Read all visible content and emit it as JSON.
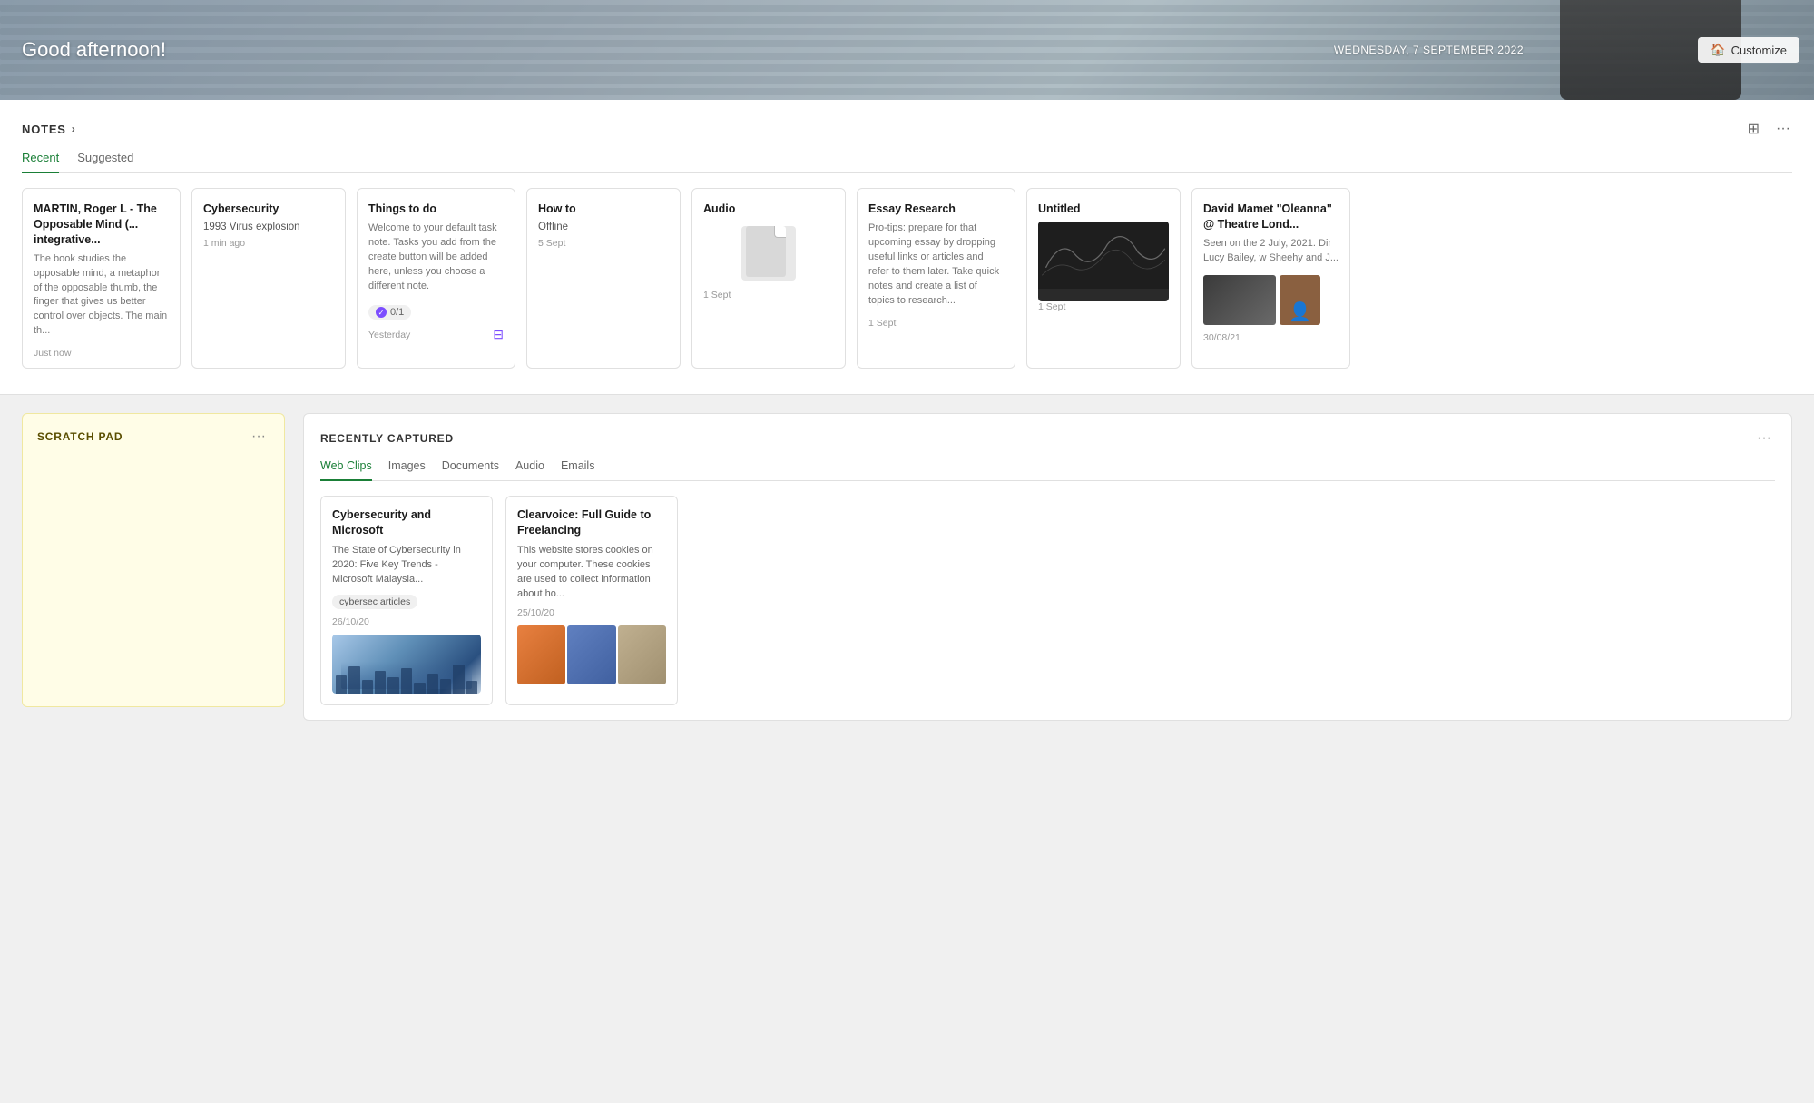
{
  "hero": {
    "greeting": "Good afternoon!",
    "date": "WEDNESDAY, 7 SEPTEMBER 2022",
    "customize_label": "Customize"
  },
  "notes": {
    "title": "NOTES",
    "tabs": [
      {
        "label": "Recent",
        "active": true
      },
      {
        "label": "Suggested",
        "active": false
      }
    ],
    "cards": [
      {
        "id": "martin",
        "title": "MARTIN, Roger L - The Opposable Mind (... integrative...",
        "subtitle": "",
        "body": "The book studies the opposable mind, a metaphor of the opposable thumb, the finger that gives us better control over objects. The main th...",
        "time": "Just now",
        "type": "text"
      },
      {
        "id": "cybersecurity",
        "title": "Cybersecurity",
        "subtitle": "1993 Virus explosion",
        "body": "",
        "time": "1 min ago",
        "type": "text"
      },
      {
        "id": "things-to-do",
        "title": "Things to do",
        "subtitle": "",
        "body": "Welcome to your default task note. Tasks you add from the create button will be added here, unless you choose a different note.",
        "time": "Yesterday",
        "type": "task",
        "todo": "0/1"
      },
      {
        "id": "how-to",
        "title": "How to",
        "subtitle": "Offline",
        "body": "",
        "time": "5 Sept",
        "type": "text"
      },
      {
        "id": "audio",
        "title": "Audio",
        "subtitle": "",
        "body": "",
        "time": "1 Sept",
        "type": "file"
      },
      {
        "id": "essay-research",
        "title": "Essay Research",
        "subtitle": "",
        "body": "Pro-tips: prepare for that upcoming essay by dropping useful links or articles and refer to them later. Take quick notes and create a list of topics to research...",
        "time": "1 Sept",
        "type": "text"
      },
      {
        "id": "untitled",
        "title": "Untitled",
        "subtitle": "",
        "body": "",
        "time": "1 Sept",
        "type": "dark-image"
      },
      {
        "id": "david-mamet",
        "title": "David Mamet \"Oleanna\" @ Theatre Lond...",
        "subtitle": "",
        "body": "Seen on the 2 July, 2021. Dir Lucy Bailey, w Sheehy and J...",
        "time": "30/08/21",
        "type": "person-image"
      }
    ]
  },
  "scratch_pad": {
    "title": "SCRATCH PAD",
    "content": ""
  },
  "recently_captured": {
    "title": "RECENTLY CAPTURED",
    "tabs": [
      {
        "label": "Web Clips",
        "active": true
      },
      {
        "label": "Images",
        "active": false
      },
      {
        "label": "Documents",
        "active": false
      },
      {
        "label": "Audio",
        "active": false
      },
      {
        "label": "Emails",
        "active": false
      }
    ],
    "cards": [
      {
        "id": "cybersec-ms",
        "title": "Cybersecurity and Microsoft",
        "body": "The State of Cybersecurity in 2020: Five Key Trends - Microsoft Malaysia...",
        "tag": "cybersec articles",
        "date": "26/10/20",
        "thumb_type": "cyber"
      },
      {
        "id": "clearvoice",
        "title": "Clearvoice: Full Guide to Freelancing",
        "body": "This website stores cookies on your computer. These cookies are used to collect information about ho...",
        "tag": "",
        "date": "25/10/20",
        "thumb_type": "multi"
      }
    ]
  }
}
